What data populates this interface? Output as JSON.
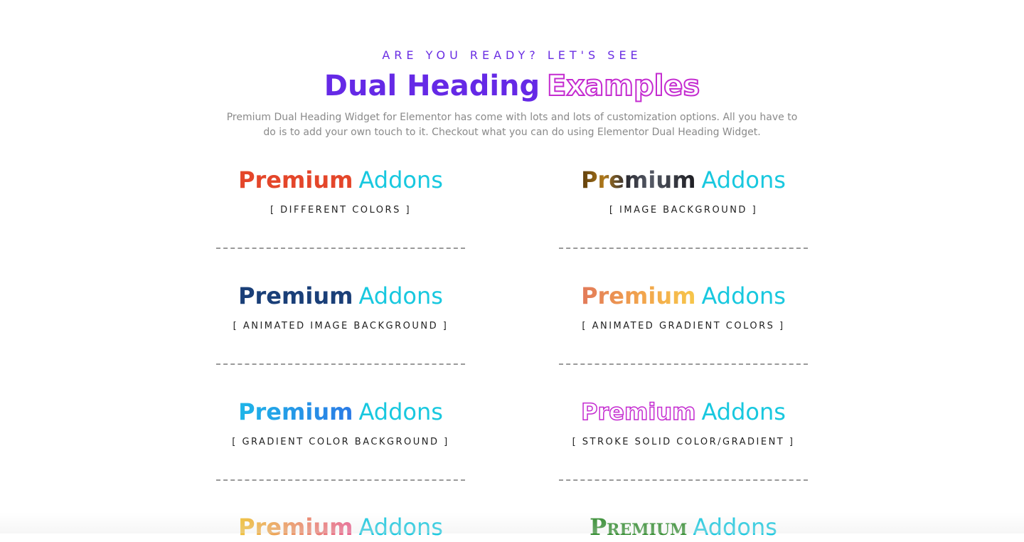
{
  "header": {
    "eyebrow": "ARE YOU READY? LET'S SEE",
    "title_first": "Dual Heading",
    "title_second": "Examples",
    "intro": "Premium Dual Heading Widget for Elementor has come with lots and lots of customization options. All you have to do is to add your own touch to it. Checkout what you can do using Elementor Dual Heading Widget."
  },
  "examples": [
    {
      "first": "Premium",
      "second": "Addons",
      "label": "[ DIFFERENT COLORS ]"
    },
    {
      "first": "Premium",
      "second": "Addons",
      "label": "[ IMAGE BACKGROUND ]"
    },
    {
      "first": "Premium",
      "second": "Addons",
      "label": "[ ANIMATED IMAGE BACKGROUND ]"
    },
    {
      "first": "Premium",
      "second": "Addons",
      "label": "[ ANIMATED GRADIENT COLORS ]"
    },
    {
      "first": "Premium",
      "second": "Addons",
      "label": "[ GRADIENT COLOR BACKGROUND ]"
    },
    {
      "first": "Premium",
      "second": "Addons",
      "label": "[ STROKE SOLID COLOR/GRADIENT ]"
    },
    {
      "first": "Premium",
      "second": "Addons"
    },
    {
      "first": "Premium",
      "second": "Addons"
    }
  ],
  "colors": {
    "accent_purple": "#6529e6",
    "accent_magenta": "#c42bd0",
    "addons_cyan": "#18c8df"
  }
}
